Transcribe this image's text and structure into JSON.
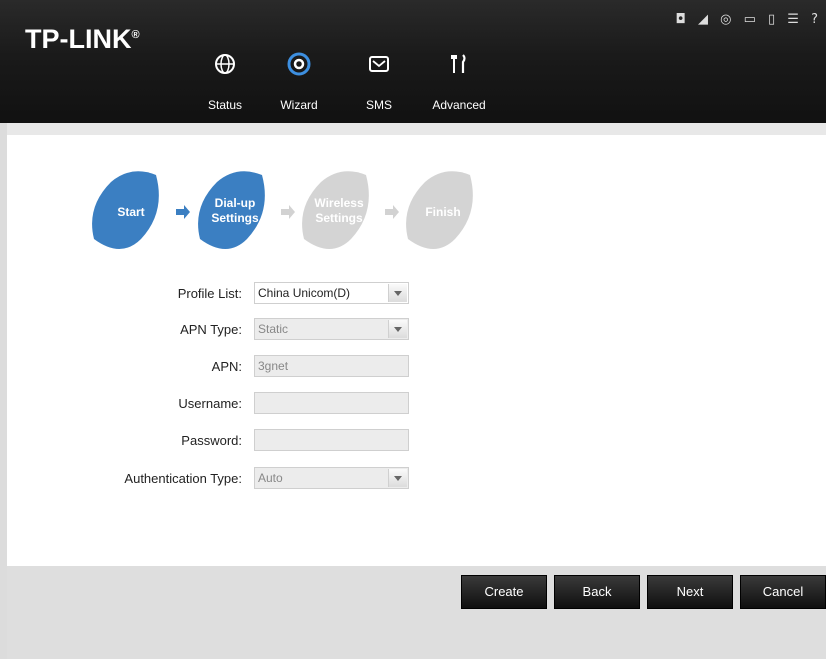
{
  "header": {
    "logo": "TP-LINK",
    "logo_mark": "®",
    "nav": [
      {
        "label": "Status",
        "icon": "globe-icon"
      },
      {
        "label": "Wizard",
        "icon": "wizard-gear-icon"
      },
      {
        "label": "SMS",
        "icon": "envelope-icon"
      },
      {
        "label": "Advanced",
        "icon": "tools-icon"
      }
    ],
    "status_icons": [
      "message-icon",
      "signal-icon",
      "globe-status-icon",
      "screen-icon",
      "battery-icon",
      "wifi-icon",
      "help-icon"
    ],
    "status_text": "◘ ◢ ◎ ▭ ▯ ☰ ?"
  },
  "steps": [
    {
      "line1": "Start",
      "line2": "",
      "state": "done"
    },
    {
      "line1": "Dial-up",
      "line2": "Settings",
      "state": "active"
    },
    {
      "line1": "Wireless",
      "line2": "Settings",
      "state": "pending"
    },
    {
      "line1": "Finish",
      "line2": "",
      "state": "pending"
    }
  ],
  "form": {
    "profile_list": {
      "label": "Profile List:",
      "value": "China Unicom(D)"
    },
    "apn_type": {
      "label": "APN Type:",
      "value": "Static"
    },
    "apn": {
      "label": "APN:",
      "value": "3gnet"
    },
    "username": {
      "label": "Username:",
      "value": ""
    },
    "password": {
      "label": "Password:",
      "value": ""
    },
    "auth_type": {
      "label": "Authentication Type:",
      "value": "Auto"
    }
  },
  "buttons": {
    "create": "Create",
    "back": "Back",
    "next": "Next",
    "cancel": "Cancel"
  },
  "colors": {
    "active_blue": "#3a7ec2",
    "pending_grey": "#cfcfcf",
    "header_dark": "#1a1a1a"
  }
}
